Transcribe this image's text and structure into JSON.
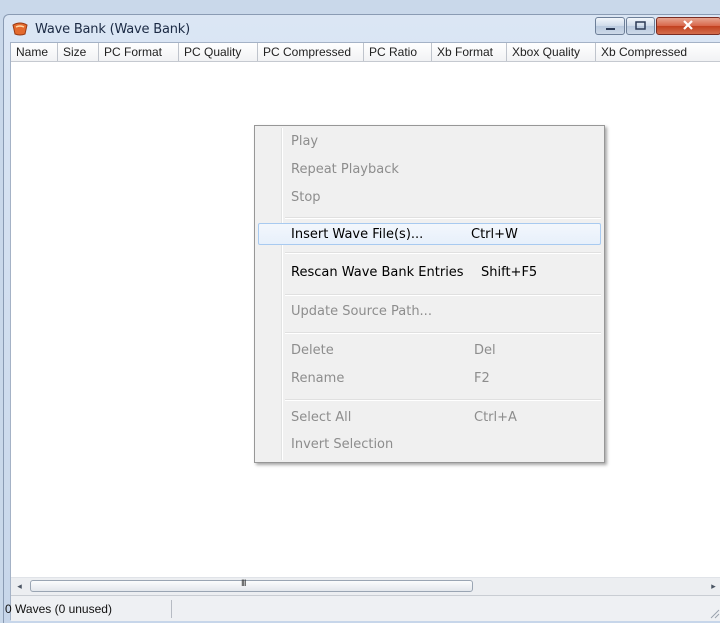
{
  "window": {
    "title": "Wave Bank (Wave Bank)",
    "colors": {
      "titlebar": "#c7d6ea",
      "close_button": "#c1401f",
      "menu_highlight_border": "#a8caf0"
    }
  },
  "columns": [
    "Name",
    "Size",
    "PC Format",
    "PC Quality",
    "PC Compressed",
    "PC Ratio",
    "Xb Format",
    "Xbox Quality",
    "Xb Compressed"
  ],
  "context_menu": {
    "play": "Play",
    "repeat": "Repeat Playback",
    "stop": "Stop",
    "insert": "Insert Wave File(s)...",
    "insert_sc": "Ctrl+W",
    "rescan": "Rescan Wave Bank Entries",
    "rescan_sc": "Shift+F5",
    "update": "Update Source Path...",
    "delete": "Delete",
    "delete_sc": "Del",
    "rename": "Rename",
    "rename_sc": "F2",
    "select_all": "Select All",
    "select_all_sc": "Ctrl+A",
    "invert": "Invert Selection"
  },
  "scrollbar": {
    "left_arrow": "◂",
    "right_arrow": "▸",
    "grip": "III"
  },
  "status": {
    "text": "0 Waves (0 unused)"
  }
}
